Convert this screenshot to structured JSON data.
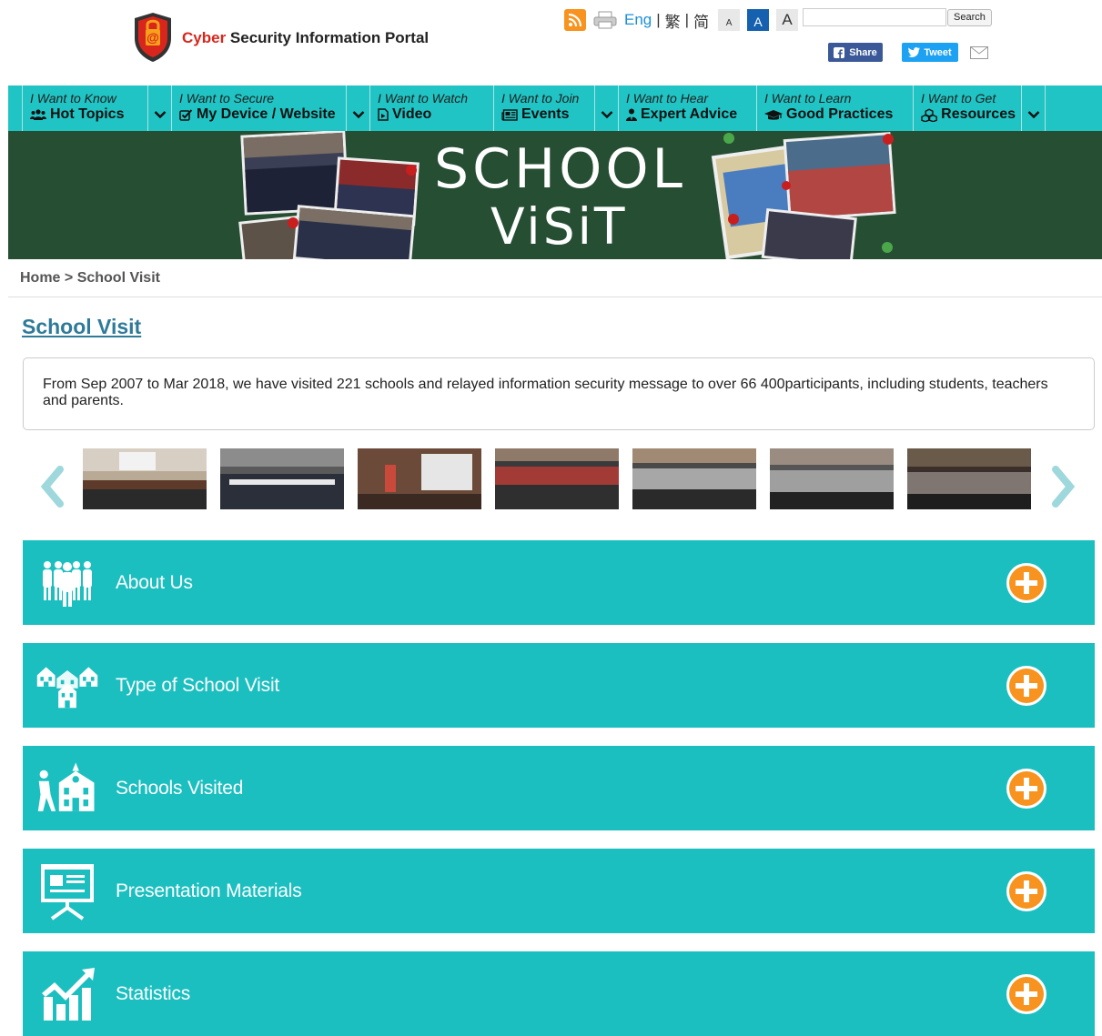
{
  "header": {
    "logo_brand": "Cyber",
    "logo_rest": "Security Information Portal",
    "lang_eng": "Eng",
    "lang_sep1": "|",
    "lang_trad": "繁",
    "lang_sep2": "|",
    "lang_simp": "简",
    "font_small": "A",
    "font_medium": "A",
    "font_large": "A",
    "search_value": "",
    "search_button": "Search",
    "share_label": "Share",
    "tweet_label": "Tweet"
  },
  "nav": {
    "items": [
      {
        "small": "I Want to Know",
        "big": "Hot Topics",
        "icon": "users-icon"
      },
      {
        "small": "I Want to Secure",
        "big": "My Device / Website",
        "icon": "checkbox-icon"
      },
      {
        "small": "I Want to Watch",
        "big": "Video",
        "icon": "video-file-icon"
      },
      {
        "small": "I Want to Join",
        "big": "Events",
        "icon": "newspaper-icon"
      },
      {
        "small": "I Want to Hear",
        "big": "Expert Advice",
        "icon": "user-tie-icon"
      },
      {
        "small": "I Want to Learn",
        "big": "Good Practices",
        "icon": "graduation-cap-icon"
      },
      {
        "small": "I Want to Get",
        "big": "Resources",
        "icon": "cubes-icon"
      }
    ]
  },
  "banner": {
    "text_line1": "SCHOOL",
    "text_line2": "ViSiT"
  },
  "breadcrumb": {
    "text": "Home > School Visit"
  },
  "page": {
    "title": "School Visit",
    "intro": "From Sep 2007 to Mar 2018, we have visited 221 schools and relayed information security message to over 66 400participants, including students, teachers and parents."
  },
  "sections": [
    {
      "title": "About Us",
      "icon": "people-group-icon"
    },
    {
      "title": "Type of School Visit",
      "icon": "school-buildings-icon"
    },
    {
      "title": "Schools Visited",
      "icon": "school-visitor-icon"
    },
    {
      "title": "Presentation Materials",
      "icon": "presentation-board-icon"
    },
    {
      "title": "Statistics",
      "icon": "growth-chart-icon"
    }
  ],
  "colors": {
    "teal": "#1bbfc0",
    "nav_teal": "#21c4c4",
    "orange": "#f7931e",
    "banner_green": "#264e33",
    "title_blue": "#2f7a99"
  }
}
